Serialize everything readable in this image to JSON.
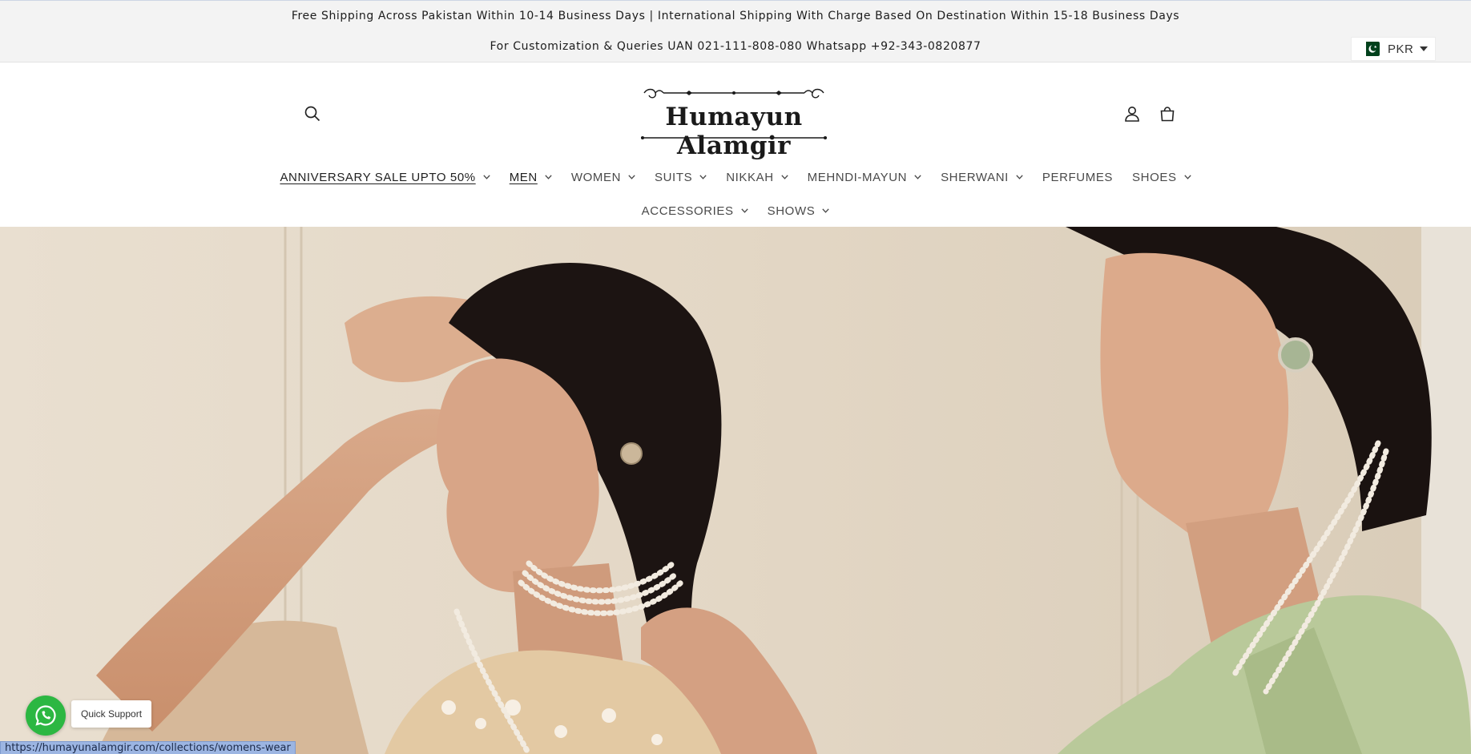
{
  "announcement": {
    "shipping": "Free Shipping Across Pakistan Within 10-14 Business Days | International Shipping With Charge Based On Destination Within 15-18 Business Days",
    "contact": "For Customization & Queries UAN 021-111-808-080 Whatsapp +92-343-0820877"
  },
  "currency": {
    "code": "PKR",
    "flag_icon": "pakistan-flag-icon"
  },
  "brand": {
    "name": "Humayun Alamgir"
  },
  "nav": {
    "row1": [
      {
        "label": "ANNIVERSARY SALE UPTO 50%",
        "underlined": true,
        "dropdown": true
      },
      {
        "label": "MEN",
        "underlined": true,
        "dropdown": true
      },
      {
        "label": "WOMEN",
        "dropdown": true
      },
      {
        "label": "SUITS",
        "dropdown": true
      },
      {
        "label": "NIKKAH",
        "dropdown": true
      },
      {
        "label": "MEHNDI-MAYUN",
        "dropdown": true
      },
      {
        "label": "SHERWANI",
        "dropdown": true
      },
      {
        "label": "PERFUMES",
        "dropdown": false
      },
      {
        "label": "SHOES",
        "dropdown": true
      }
    ],
    "row2": [
      {
        "label": "ACCESSORIES",
        "dropdown": true
      },
      {
        "label": "SHOWS",
        "dropdown": true
      }
    ]
  },
  "header_icons": [
    "search-icon",
    "account-icon",
    "cart-icon"
  ],
  "support": {
    "label": "Quick Support",
    "icon": "whatsapp-icon"
  },
  "status_url": "https://humayunalamgir.com/collections/womens-wear",
  "colors": {
    "announcement_bg": "#f3f3f3",
    "whatsapp": "#2cb742",
    "hero_bg": "#e6dccd",
    "left_outfit": "#e3c9a3",
    "right_outfit": "#b9c99a"
  }
}
